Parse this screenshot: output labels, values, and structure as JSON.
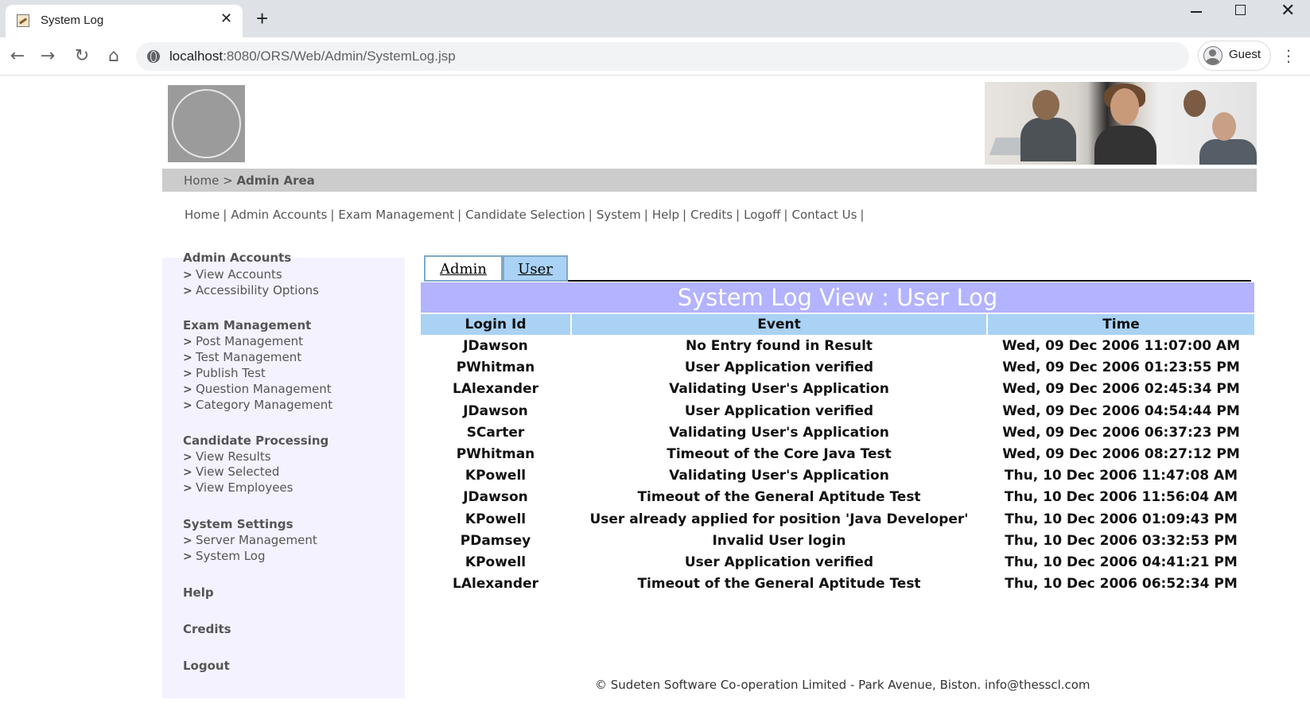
{
  "browser": {
    "tab_title": "System Log",
    "tab_close": "✕",
    "new_tab": "+",
    "url_host": "localhost",
    "url_rest": ":8080/ORS/Web/Admin/SystemLog.jsp",
    "profile_label": "Guest"
  },
  "header": {
    "breadcrumb_home": "Home",
    "breadcrumb_sep": ">",
    "breadcrumb_current": "Admin Area"
  },
  "topnav": [
    "Home",
    "Admin Accounts",
    "Exam Management",
    "Candidate Selection",
    "System",
    "Help",
    "Credits",
    "Logoff",
    "Contact Us"
  ],
  "topnav_sep": "|",
  "sidebar": {
    "sections": [
      {
        "title": "Admin Accounts",
        "items": [
          "View Accounts",
          "Accessibility Options"
        ]
      },
      {
        "title": "Exam Management",
        "items": [
          "Post Management",
          "Test Management",
          "Publish Test",
          "Question Management",
          "Category Management"
        ]
      },
      {
        "title": "Candidate Processing",
        "items": [
          "View Results",
          "View Selected",
          "View Employees"
        ]
      },
      {
        "title": "System Settings",
        "items": [
          "Server Management",
          "System Log"
        ]
      },
      {
        "title": "Help",
        "items": []
      },
      {
        "title": "Credits",
        "items": []
      },
      {
        "title": "Logout",
        "items": []
      }
    ]
  },
  "tabs": {
    "admin": "Admin",
    "user": "User",
    "active": "User"
  },
  "log": {
    "title": "System Log View : User Log",
    "columns": [
      "Login Id",
      "Event",
      "Time"
    ],
    "rows": [
      [
        "JDawson",
        "No Entry found in Result",
        "Wed, 09 Dec 2006 11:07:00 AM"
      ],
      [
        "PWhitman",
        "User Application verified",
        "Wed, 09 Dec 2006 01:23:55 PM"
      ],
      [
        "LAlexander",
        "Validating User's Application",
        "Wed, 09 Dec 2006 02:45:34 PM"
      ],
      [
        "JDawson",
        "User Application verified",
        "Wed, 09 Dec 2006 04:54:44 PM"
      ],
      [
        "SCarter",
        "Validating User's Application",
        "Wed, 09 Dec 2006 06:37:23 PM"
      ],
      [
        "PWhitman",
        "Timeout of the Core Java Test",
        "Wed, 09 Dec 2006 08:27:12 PM"
      ],
      [
        "KPowell",
        "Validating User's Application",
        "Thu, 10 Dec 2006 11:47:08 AM"
      ],
      [
        "JDawson",
        "Timeout of the General Aptitude Test",
        "Thu, 10 Dec 2006 11:56:04 AM"
      ],
      [
        "KPowell",
        "User already applied for position 'Java Developer'",
        "Thu, 10 Dec 2006 01:09:43 PM"
      ],
      [
        "PDamsey",
        "Invalid User login",
        "Thu, 10 Dec 2006 03:32:53 PM"
      ],
      [
        "KPowell",
        "User Application verified",
        "Thu, 10 Dec 2006 04:41:21 PM"
      ],
      [
        "LAlexander",
        "Timeout of the General Aptitude Test",
        "Thu, 10 Dec 2006 06:52:34 PM"
      ]
    ]
  },
  "footer": "© Sudeten Software Co-operation Limited - Park Avenue, Biston. info@thesscl.com",
  "colors": {
    "title_bar": "#b3b3ff",
    "table_header": "#a9d2f4",
    "sidebar_bg": "#f4f2fe",
    "breadcrumb_bg": "#cccccc"
  },
  "icons": [
    "back-arrow-icon",
    "forward-arrow-icon",
    "reload-icon",
    "home-icon",
    "site-info-icon",
    "profile-avatar-icon",
    "kebab-menu-icon",
    "chevron-right-icon"
  ]
}
